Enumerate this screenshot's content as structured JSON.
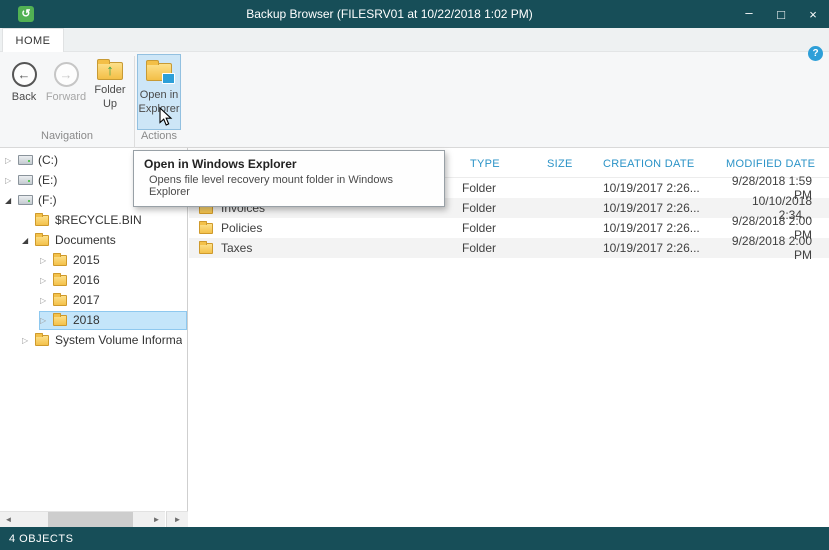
{
  "window": {
    "title": "Backup Browser (FILESRV01 at 10/22/2018 1:02 PM)",
    "controls": {
      "minimize": "–",
      "maximize": "□",
      "close": "×"
    }
  },
  "icons": {
    "app_glyph": "↺",
    "back_arrow": "←",
    "forward_arrow": "→",
    "up_arrow": "↑",
    "help": "?",
    "expander_collapsed": "▷",
    "expander_expanded": "◢",
    "scroll_left": "◄",
    "scroll_right": "►"
  },
  "ribbon": {
    "tab": "HOME",
    "back_label": "Back",
    "forward_label": "Forward",
    "folder_up_line1": "Folder",
    "folder_up_line2": "Up",
    "open_line1": "Open in",
    "open_line2": "Explorer",
    "group_navigation": "Navigation",
    "group_actions": "Actions"
  },
  "tooltip": {
    "title": "Open in Windows Explorer",
    "body": "Opens file level recovery mount folder in Windows Explorer"
  },
  "tree": {
    "items": [
      {
        "label": "(C:)",
        "level": 0,
        "expander": "collapsed",
        "icon": "drive",
        "selected": false
      },
      {
        "label": "(E:)",
        "level": 0,
        "expander": "collapsed",
        "icon": "drive",
        "selected": false
      },
      {
        "label": "(F:)",
        "level": 0,
        "expander": "expanded",
        "icon": "drive",
        "selected": false
      },
      {
        "label": "$RECYCLE.BIN",
        "level": 1,
        "expander": "none",
        "icon": "folder",
        "selected": false
      },
      {
        "label": "Documents",
        "level": 1,
        "expander": "expanded",
        "icon": "folder",
        "selected": false
      },
      {
        "label": "2015",
        "level": 2,
        "expander": "collapsed",
        "icon": "folder",
        "selected": false
      },
      {
        "label": "2016",
        "level": 2,
        "expander": "collapsed",
        "icon": "folder",
        "selected": false
      },
      {
        "label": "2017",
        "level": 2,
        "expander": "collapsed",
        "icon": "folder",
        "selected": false
      },
      {
        "label": "2018",
        "level": 2,
        "expander": "collapsed",
        "icon": "folder",
        "selected": true
      },
      {
        "label": "System Volume Informa",
        "level": 1,
        "expander": "collapsed",
        "icon": "folder",
        "selected": false
      }
    ]
  },
  "list": {
    "columns": {
      "type": "TYPE",
      "size": "SIZE",
      "creation": "CREATION DATE",
      "modified": "MODIFIED DATE"
    },
    "rows": [
      {
        "name": "",
        "type": "Folder",
        "size": "",
        "creation": "10/19/2017 2:26...",
        "modified": "9/28/2018 1:59 PM"
      },
      {
        "name": "Invoices",
        "type": "Folder",
        "size": "",
        "creation": "10/19/2017 2:26...",
        "modified": "10/10/2018 2:34..."
      },
      {
        "name": "Policies",
        "type": "Folder",
        "size": "",
        "creation": "10/19/2017 2:26...",
        "modified": "9/28/2018 2:00 PM"
      },
      {
        "name": "Taxes",
        "type": "Folder",
        "size": "",
        "creation": "10/19/2017 2:26...",
        "modified": "9/28/2018 2:00 PM"
      }
    ]
  },
  "statusbar": {
    "text": "4 OBJECTS"
  }
}
